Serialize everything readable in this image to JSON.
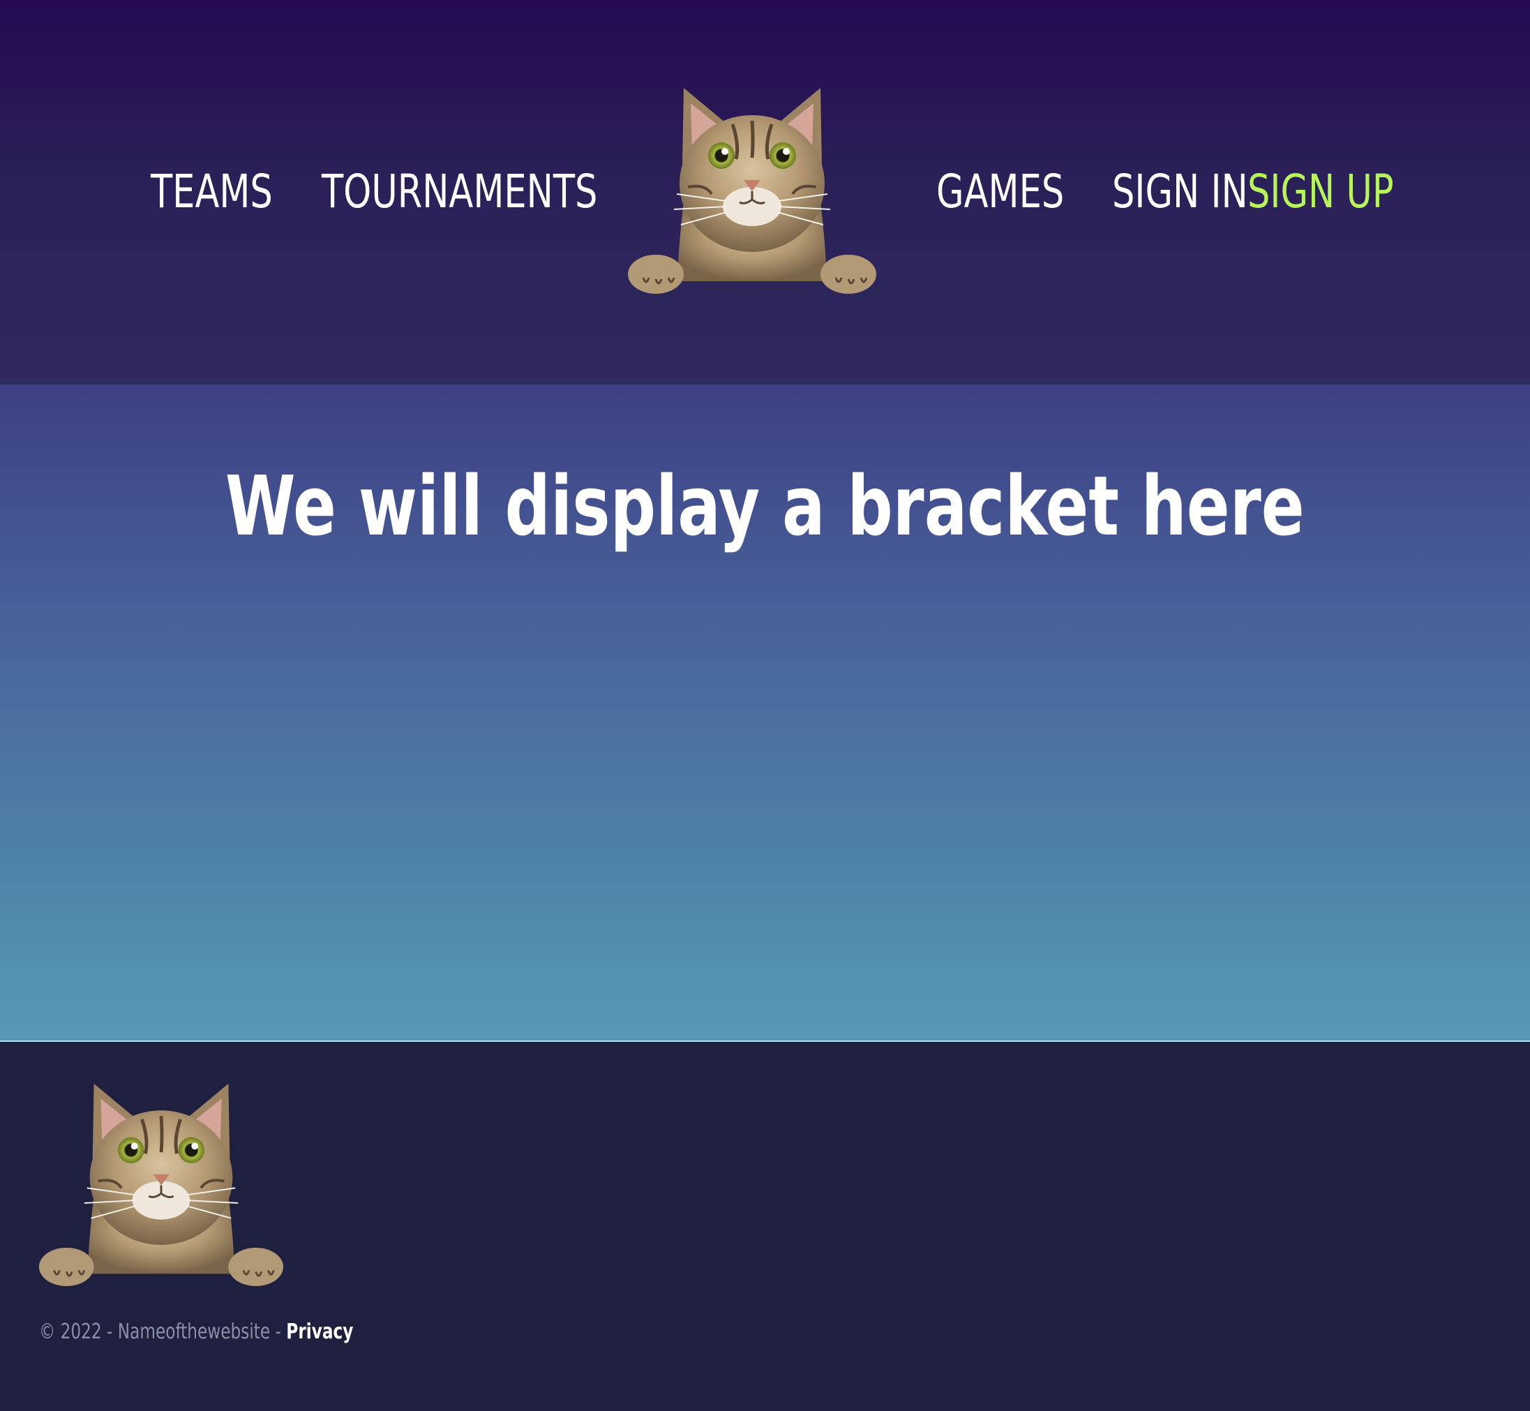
{
  "header": {
    "nav_left": [
      {
        "label": "TEAMS"
      },
      {
        "label": "TOURNAMENTS"
      }
    ],
    "nav_right": [
      {
        "label": "GAMES"
      }
    ],
    "auth": {
      "sign_in": "SIGN IN",
      "sign_up": "SIGN UP"
    },
    "logo_icon": "cat-logo-icon"
  },
  "main": {
    "title": "We will display a bracket here"
  },
  "footer": {
    "logo_icon": "cat-logo-icon",
    "copyright": "© 2022 - Nameofthewebsite - ",
    "privacy_label": "Privacy"
  },
  "colors": {
    "header_top": "#250a51",
    "header_bottom": "#2e2b5e",
    "main_top": "#3d3f84",
    "main_bottom": "#5799b4",
    "footer_bg": "#1f1f40",
    "sign_up_accent": "#b8f55a",
    "text": "#ffffff",
    "muted_text": "#8e8ea5"
  }
}
